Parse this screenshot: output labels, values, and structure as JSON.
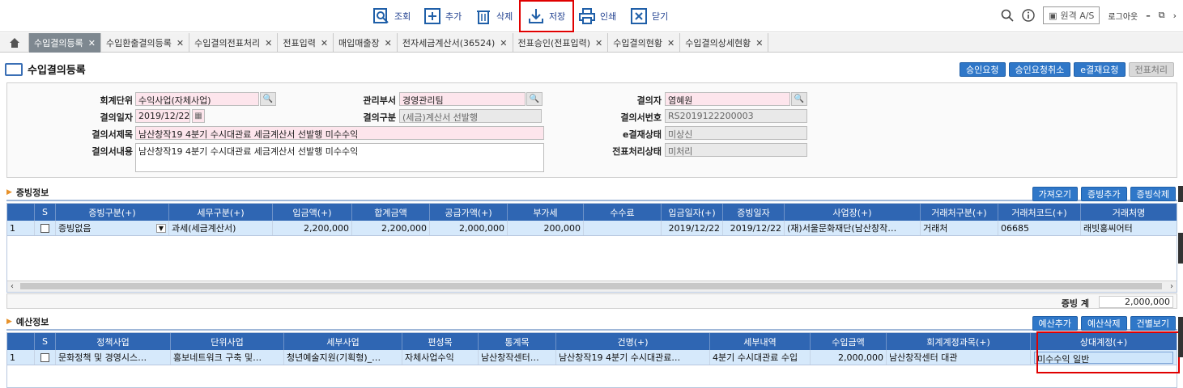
{
  "toolbar": {
    "buttons": [
      {
        "label": "조회",
        "icon": "search-doc-icon"
      },
      {
        "label": "추가",
        "icon": "plus-box-icon"
      },
      {
        "label": "삭제",
        "icon": "trash-icon"
      },
      {
        "label": "저장",
        "icon": "download-icon"
      },
      {
        "label": "인쇄",
        "icon": "printer-icon"
      },
      {
        "label": "닫기",
        "icon": "close-box-icon"
      }
    ],
    "remote_label": "원격 A/S",
    "logout_label": "로그아웃"
  },
  "tabs": [
    {
      "label": "수입결의등록",
      "active": true
    },
    {
      "label": "수입환출결의등록"
    },
    {
      "label": "수입결의전표처리"
    },
    {
      "label": "전표입력"
    },
    {
      "label": "매입매출장"
    },
    {
      "label": "전자세금계산서(36524)"
    },
    {
      "label": "전표승인(전표입력)"
    },
    {
      "label": "수입결의현황"
    },
    {
      "label": "수입결의상세현황"
    }
  ],
  "page": {
    "title": "수입결의등록",
    "buttons": [
      "승인요청",
      "승인요청취소",
      "e결재요청",
      "전표처리"
    ]
  },
  "form": {
    "unit": {
      "label": "회계단위",
      "value": "수익사업(자체사업)"
    },
    "dept": {
      "label": "관리부서",
      "value": "경영관리팀"
    },
    "approver": {
      "label": "결의자",
      "value": "염혜원"
    },
    "date": {
      "label": "결의일자",
      "value": "2019/12/22"
    },
    "type": {
      "label": "결의구분",
      "value": "(세금)계산서 선발행"
    },
    "number": {
      "label": "결의서번호",
      "value": "RS2019122200003"
    },
    "subject": {
      "label": "결의서제목",
      "value": "남산창작19 4분기 수시대관료 세금계산서 선발행 미수수익"
    },
    "content": {
      "label": "결의서내용",
      "value": "남산창작19 4분기 수시대관료 세금계산서 선발행 미수수익"
    },
    "eapproval": {
      "label": "e결재상태",
      "value": "미상신"
    },
    "voucher": {
      "label": "전표처리상태",
      "value": "미처리"
    }
  },
  "evidence": {
    "title": "증빙정보",
    "buttons": [
      "가져오기",
      "증빙추가",
      "증빙삭제"
    ],
    "columns": [
      "S",
      "증빙구분(+)",
      "세무구분(+)",
      "입금액(+)",
      "합계금액",
      "공급가액(+)",
      "부가세",
      "수수료",
      "입금일자(+)",
      "증빙일자",
      "사업장(+)",
      "거래처구분(+)",
      "거래처코드(+)",
      "거래처명"
    ],
    "row": {
      "no": "1",
      "type": "증빙없음",
      "tax": "과세(세금계산서)",
      "deposit": "2,200,000",
      "total": "2,200,000",
      "supply": "2,000,000",
      "vat": "200,000",
      "fee": "",
      "deposit_date": "2019/12/22",
      "evidence_date": "2019/12/22",
      "site": "(재)서울문화재단(남산창작…",
      "client_type": "거래처",
      "client_code": "06685",
      "client_name": "래빗홍씨어터"
    },
    "sum_label": "증빙 계",
    "sum_value": "2,000,000"
  },
  "budget": {
    "title": "예산정보",
    "buttons": [
      "예산추가",
      "예산삭제",
      "건별보기"
    ],
    "columns": [
      "S",
      "정책사업",
      "단위사업",
      "세부사업",
      "편성목",
      "통계목",
      "건명(+)",
      "세부내역",
      "수입금액",
      "회계계정과목(+)",
      "상대계정(+)"
    ],
    "row": {
      "no": "1",
      "policy": "문화정책 및 경영시스…",
      "unit": "홍보네트워크 구축 및…",
      "detail": "청년예술지원(기획형)_…",
      "budget_item": "자체사업수익",
      "stat_item": "남산창작센터…",
      "name": "남산창작19 4분기 수시대관료…",
      "desc": "4분기 수시대관료 수입",
      "amount": "2,000,000",
      "account": "남산창작센터 대관",
      "counter": "미수수익 일반"
    }
  }
}
